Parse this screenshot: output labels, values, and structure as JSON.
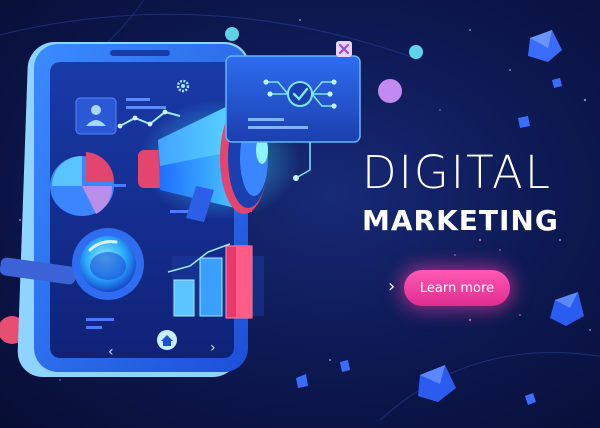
{
  "headline": {
    "line1": "DIGITAL",
    "line2": "MARKETING"
  },
  "cta": {
    "arrow": "›",
    "label": "Learn more"
  },
  "colors": {
    "background": "#0e1a55",
    "accent_pink": "#e02c8f",
    "accent_cyan": "#35d7ff",
    "text": "#ffffff"
  },
  "illustration": {
    "icons": [
      "smartphone-icon",
      "megaphone-icon",
      "pie-chart-icon",
      "magnifier-icon",
      "bar-chart-icon",
      "line-chart-icon",
      "user-profile-icon",
      "home-icon",
      "chevron-left-icon",
      "chevron-right-icon",
      "close-icon",
      "checkmark-icon",
      "gear-icon"
    ]
  }
}
